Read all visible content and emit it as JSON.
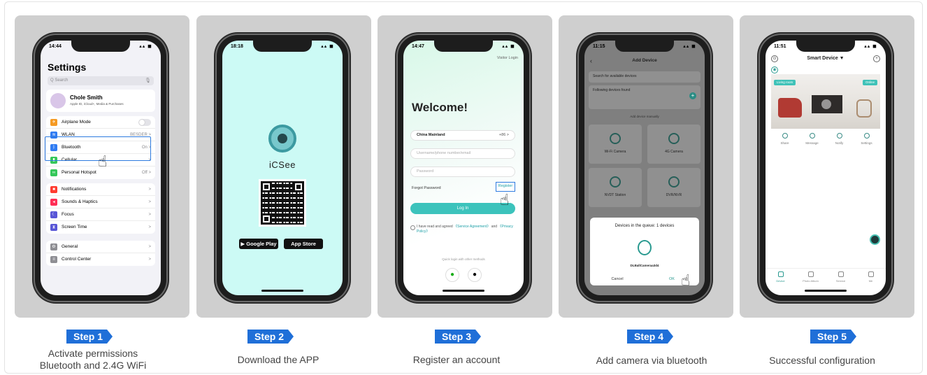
{
  "steps": [
    {
      "badge": "Step 1",
      "caption_line1": "Activate permissions",
      "caption_line2": "Bluetooth and 2.4G WiFi",
      "screen": {
        "time": "14:44",
        "title": "Settings",
        "search_placeholder": "Q Search",
        "profile_name": "Chole Smith",
        "profile_sub": "Apple ID, iCloud+, Media & Purchases",
        "rows_group1": [
          {
            "label": "Airplane Mode",
            "value": "",
            "color": "#f59a23"
          },
          {
            "label": "WLAN",
            "value": "BESDER >",
            "color": "#2f7bf2"
          },
          {
            "label": "Bluetooth",
            "value": "On >",
            "color": "#2f7bf2"
          },
          {
            "label": "Cellular",
            "value": ">",
            "color": "#34c759"
          },
          {
            "label": "Personal Hotspot",
            "value": "Off >",
            "color": "#34c759"
          }
        ],
        "rows_group2": [
          {
            "label": "Notifications",
            "value": ">",
            "color": "#ff3b30"
          },
          {
            "label": "Sounds & Haptics",
            "value": ">",
            "color": "#ff2d55"
          },
          {
            "label": "Focus",
            "value": ">",
            "color": "#5856d6"
          },
          {
            "label": "Screen Time",
            "value": ">",
            "color": "#5856d6"
          }
        ],
        "rows_group3": [
          {
            "label": "General",
            "value": ">",
            "color": "#8e8e93"
          },
          {
            "label": "Control Center",
            "value": ">",
            "color": "#8e8e93"
          }
        ]
      }
    },
    {
      "badge": "Step 2",
      "caption": "Download the APP",
      "screen": {
        "time": "18:18",
        "app_name": "iCSee",
        "google_play": "Google Play",
        "app_store": "App Store"
      }
    },
    {
      "badge": "Step 3",
      "caption": "Register an account",
      "screen": {
        "time": "14:47",
        "visitor": "Visitor Login",
        "welcome": "Welcome!",
        "region": "China Mainland",
        "region_code": "+86 >",
        "username_placeholder": "Username/phone number/email",
        "password_placeholder": "Password",
        "forgot": "Forgot Password",
        "register": "Register",
        "login": "Log In",
        "agree_text": "I have read and agreed",
        "service_link": "《Service Agreement》",
        "and": "and",
        "privacy_link": "《Privacy Policy》",
        "quick_login": "Quick login with other methods"
      }
    },
    {
      "badge": "Step 4",
      "caption": "Add camera via bluetooth",
      "screen": {
        "time": "11:15",
        "title": "Add Device",
        "search_label": "Search for available devices",
        "found_label": "Following devices found",
        "manual_label": "Add device manually",
        "tiles": [
          "Wi-Fi Camera",
          "4G Camera",
          "NVDT Station",
          "DVR/NVR"
        ],
        "dialog_title": "Devices in the queue: 1 devices",
        "device_name": "DLBallCameraa3d4",
        "cancel": "Cancel",
        "ok": "OK"
      }
    },
    {
      "badge": "Step 5",
      "caption": "Successful configuration",
      "screen": {
        "time": "11:51",
        "title": "Smart Device ▼",
        "room_tag": "Living room",
        "status_tag": "Online",
        "actions": [
          "Share",
          "Message",
          "Notify",
          "Settings"
        ],
        "tabs": [
          "Device",
          "Photo Album",
          "Service",
          "Me"
        ]
      }
    }
  ]
}
